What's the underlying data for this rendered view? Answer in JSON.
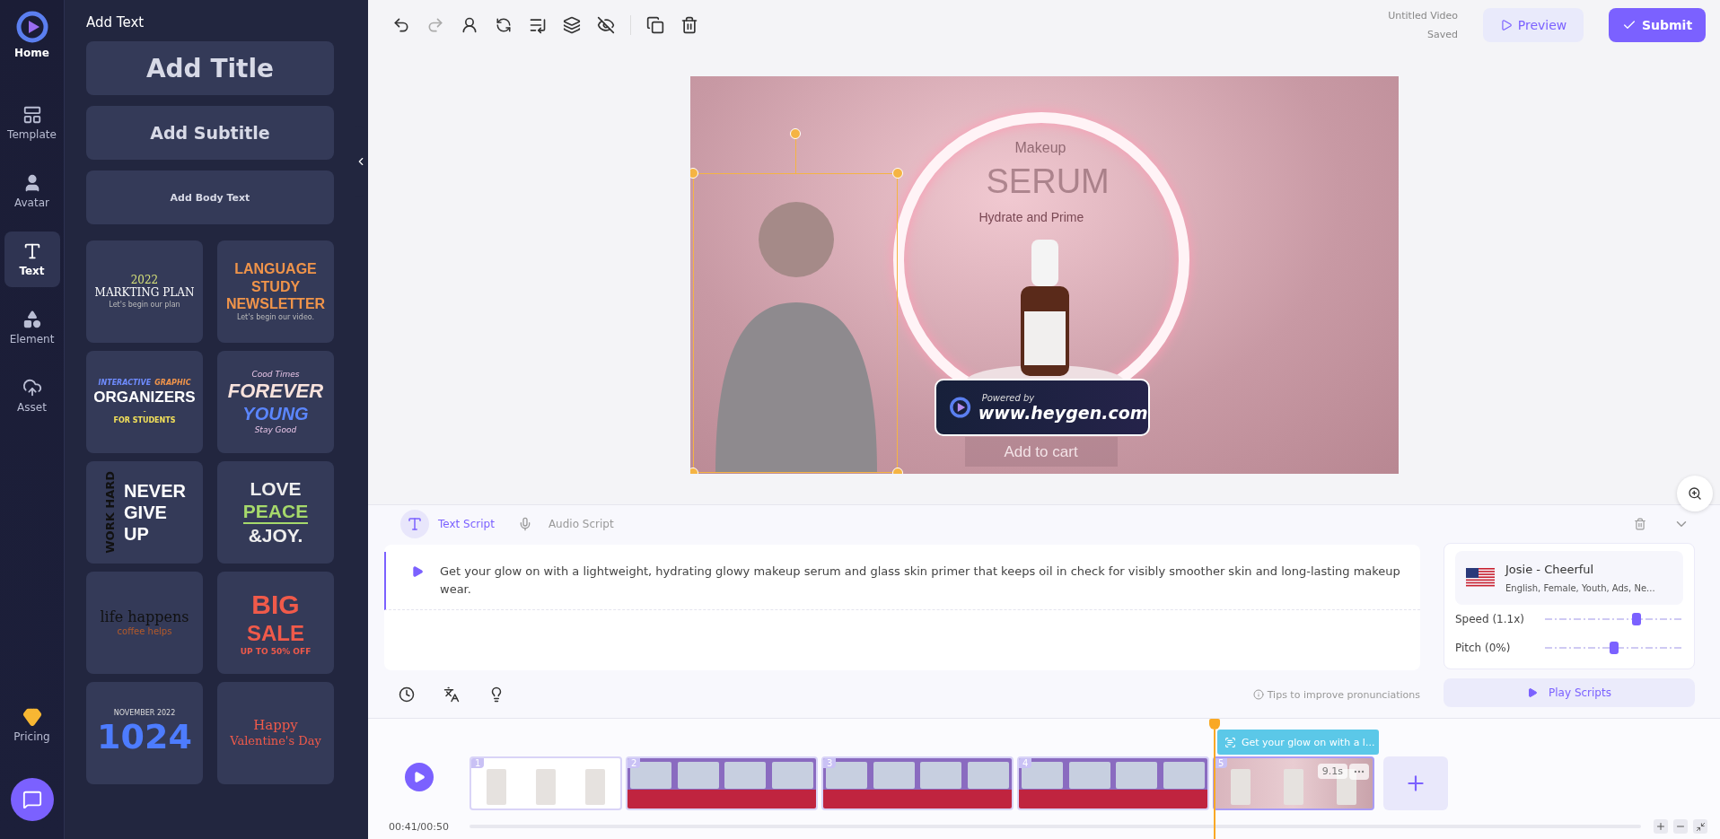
{
  "nav": {
    "home": "Home",
    "items": [
      {
        "label": "Template",
        "selected": false
      },
      {
        "label": "Avatar",
        "selected": false
      },
      {
        "label": "Text",
        "selected": true
      },
      {
        "label": "Element",
        "selected": false
      },
      {
        "label": "Asset",
        "selected": false
      }
    ],
    "pricing": "Pricing"
  },
  "panel": {
    "title": "Add Text",
    "presets": [
      {
        "label": "Add Title",
        "kind": "title"
      },
      {
        "label": "Add Subtitle",
        "kind": "subtitle"
      },
      {
        "label": "Add Body Text",
        "kind": "body"
      }
    ],
    "templates": [
      {
        "rows": [
          [
            "2022"
          ],
          [
            "MARKTING PLAN"
          ],
          [
            "Let's begin our plan"
          ]
        ]
      },
      {
        "rows": [
          [
            "LANGUAGE"
          ],
          [
            "STUDY"
          ],
          [
            "NEWSLETTER"
          ],
          [
            "Let's begin our video."
          ]
        ]
      },
      {
        "rows": [
          [
            "INTERACTIVE",
            "GRAPHIC"
          ],
          [
            "ORGANIZERS"
          ],
          [
            "-"
          ],
          [
            "FOR STUDENTS"
          ]
        ]
      },
      {
        "rows": [
          [
            "Cood Times"
          ],
          [
            "FOREVER"
          ],
          [
            "YOUNG"
          ],
          [
            "Stay Good"
          ]
        ]
      },
      {
        "side": "WORK HARD",
        "rows": [
          [
            "NEVER"
          ],
          [
            "GIVE"
          ],
          [
            "UP"
          ]
        ]
      },
      {
        "rows": [
          [
            "LOVE"
          ],
          [
            "PEACE"
          ],
          [
            "&JOY."
          ]
        ]
      },
      {
        "rows": [
          [
            "life happens"
          ],
          [
            "coffee helps"
          ]
        ]
      },
      {
        "rows": [
          [
            "BIG"
          ],
          [
            "SALE"
          ],
          [
            "UP TO 50% OFF"
          ]
        ]
      },
      {
        "rows": [
          [
            "NOVEMBER 2022"
          ],
          [
            "1024"
          ]
        ]
      },
      {
        "rows": [
          [
            "Happy"
          ],
          [
            "Valentine's Day"
          ]
        ]
      }
    ]
  },
  "toolbar": {
    "project_title": "Untitled Video",
    "save_status": "Saved",
    "preview": "Preview",
    "submit": "Submit"
  },
  "canvas": {
    "heading": "SERUM",
    "overlay": "Makeup",
    "tagline": "Hydrate and Prime",
    "cta": "Add to cart",
    "badge_caption": "Powered by",
    "badge_site": "www.heygen.com"
  },
  "script": {
    "tabs": [
      {
        "label": "Text Script",
        "kind": "text",
        "selected": true
      },
      {
        "label": "Audio Script",
        "kind": "audio",
        "selected": false
      }
    ],
    "text": "Get your glow on with a lightweight, hydrating glowy makeup serum and glass skin primer that keeps oil in check for visibly smoother skin and long-lasting makeup wear.",
    "tips": "Tips to improve pronunciations"
  },
  "voice": {
    "name": "Josie - Cheerful",
    "tags": "English, Female, Youth, Ads, Ne...",
    "sliders": [
      {
        "label": "Speed (1.1x)",
        "level": 0.66
      },
      {
        "label": "Pitch (0%)",
        "level": 0.5
      }
    ],
    "play": "Play Scripts"
  },
  "timeline": {
    "time": "00:41/00:50",
    "caption": "Get your glow on with a l...",
    "scenes": [
      {
        "number": "1",
        "kind": "studio",
        "selected": false
      },
      {
        "number": "2",
        "kind": "news",
        "selected": false
      },
      {
        "number": "3",
        "kind": "news",
        "selected": false
      },
      {
        "number": "4",
        "kind": "news",
        "selected": false
      },
      {
        "number": "5",
        "kind": "product",
        "selected": true,
        "duration": "9.1s"
      }
    ]
  }
}
